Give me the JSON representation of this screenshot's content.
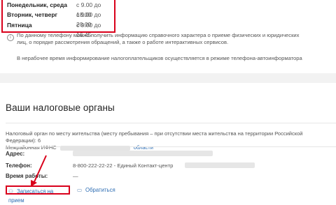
{
  "schedule": [
    {
      "day": "Понедельник, среда",
      "time": "с 9.00 до 18.00"
    },
    {
      "day": "Вторник, четверг",
      "time": "с 9.00 до 20.00"
    },
    {
      "day": "Пятница",
      "time": "с 9.00 до 16.45"
    }
  ],
  "info": {
    "icon": "info-icon",
    "text": "По данному телефону можно получить информацию справочного характера о приеме физических и юридических лиц, о порядке рассмотрения обращений, а также о работе интерактивных сервисов.",
    "phone_note": "В нерабочее время информирование налогоплательщиков осуществляется в режиме телефона-автоинформатора"
  },
  "tax_bodies": {
    "title": "Ваши налоговые органы",
    "description": "Налоговый орган по месту жительства (месту пребывания – при отсутствии места жительства на территории Российской Федерации): 6",
    "description_line2_prefix": "Межрайонная ИФНС",
    "region_link": "области",
    "address_label": "Адрес:",
    "phone_label": "Телефон:",
    "phone_value": "8-800-222-22-22 - Единый Контакт-центр",
    "hours_label": "Время работы:",
    "hours_value": "—"
  },
  "actions": {
    "appointment_label": "Записаться на прием",
    "appeal_label": "Обратиться"
  },
  "colors": {
    "highlight": "#d9001b",
    "link": "#2d6db3"
  }
}
